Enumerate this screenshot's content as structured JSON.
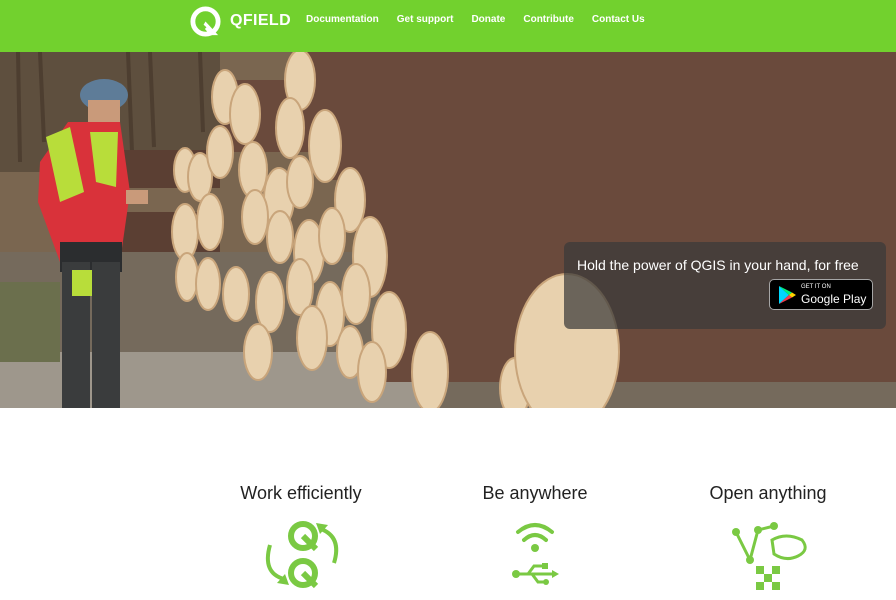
{
  "header": {
    "logo_text": "QFIELD",
    "nav": [
      {
        "label": "Documentation"
      },
      {
        "label": "Get support"
      },
      {
        "label": "Donate"
      },
      {
        "label": "Contribute"
      },
      {
        "label": "Contact Us"
      }
    ]
  },
  "hero": {
    "promo_text": "Hold the power of QGIS in your hand, for free",
    "store_badge": {
      "small": "GET IT ON",
      "big": "Google Play"
    }
  },
  "features": [
    {
      "title": "Work efficiently",
      "icon": "sync-icon"
    },
    {
      "title": "Be anywhere",
      "icon": "wifi-usb-icon"
    },
    {
      "title": "Open anything",
      "icon": "vector-raster-icon"
    }
  ],
  "colors": {
    "brand_green": "#72d12e",
    "icon_green": "#7ac943"
  }
}
